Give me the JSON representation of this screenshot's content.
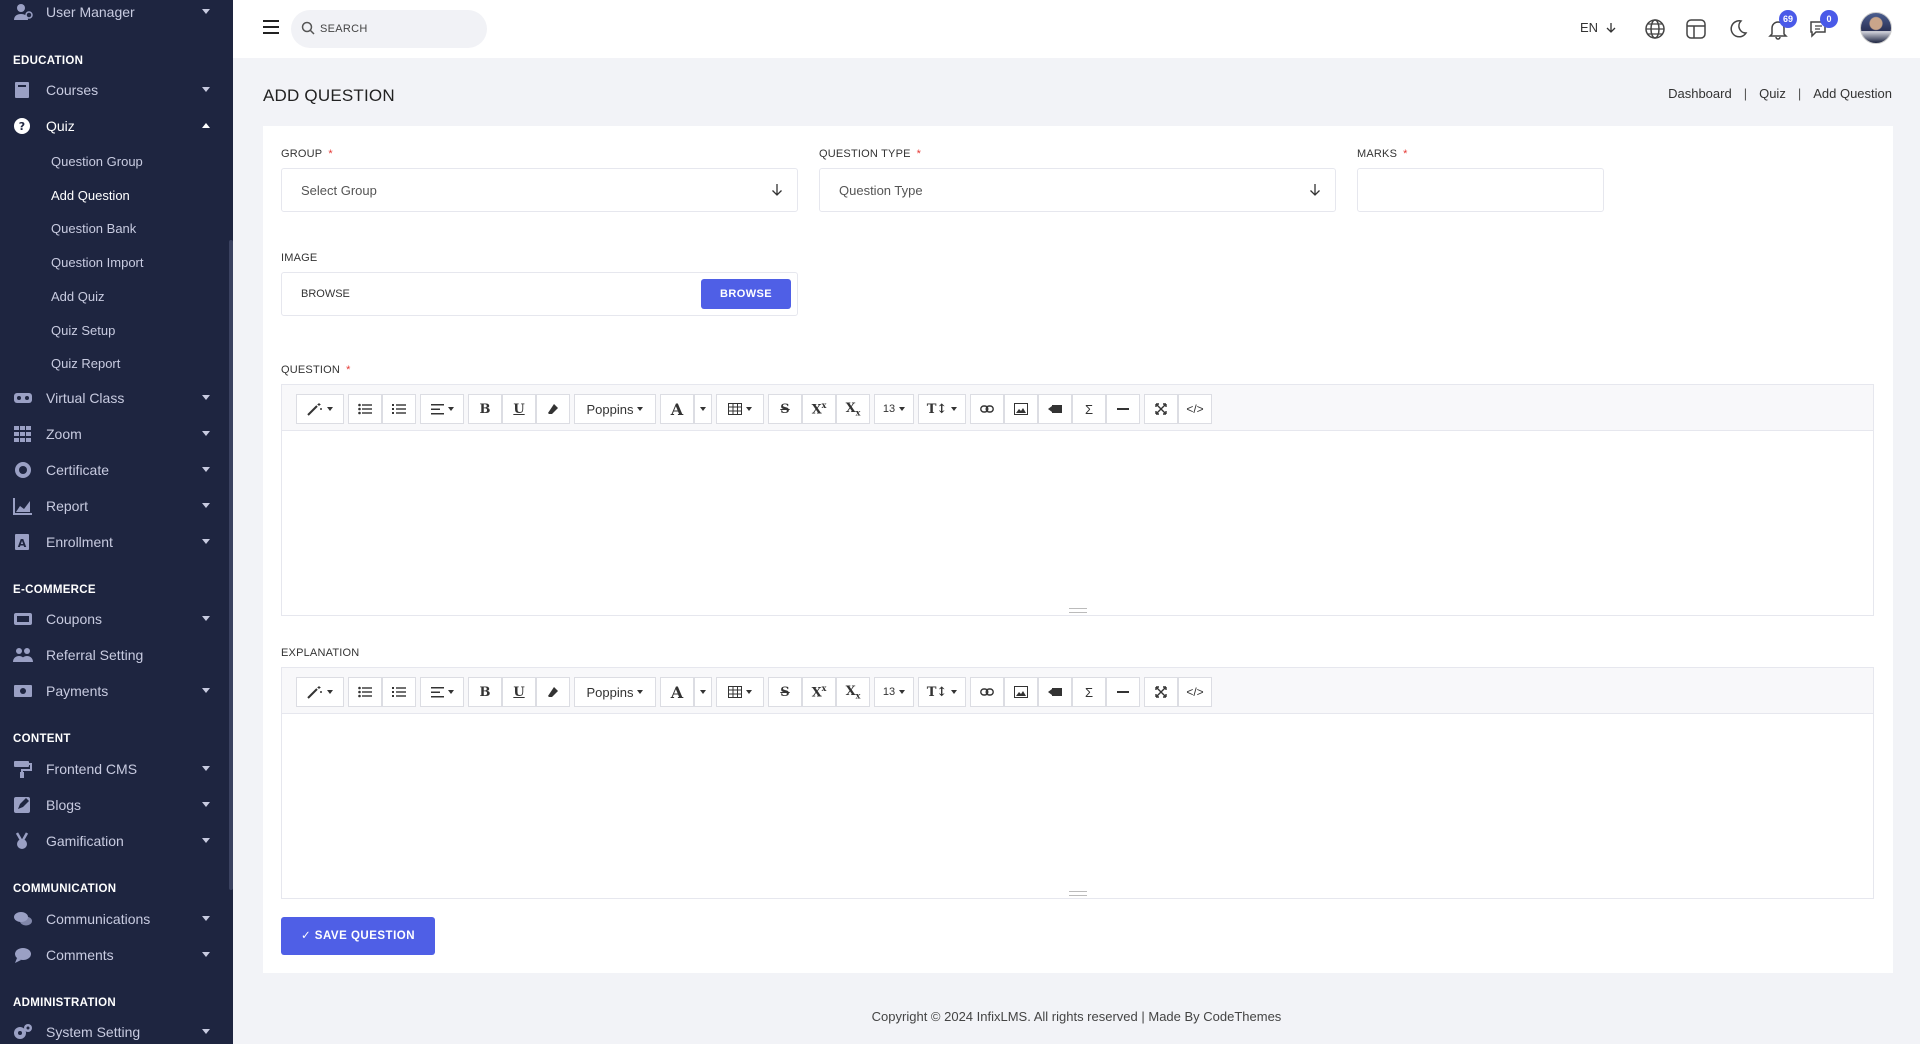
{
  "sidebar": {
    "top_item": {
      "label": "User Manager",
      "icon": "user-gear-icon"
    },
    "sections": [
      {
        "heading": "EDUCATION"
      },
      {
        "heading": "E-COMMERCE"
      },
      {
        "heading": "CONTENT"
      },
      {
        "heading": "COMMUNICATION"
      },
      {
        "heading": "ADMINISTRATION"
      }
    ],
    "items": {
      "courses": "Courses",
      "quiz": "Quiz",
      "virtual_class": "Virtual Class",
      "zoom": "Zoom",
      "certificate": "Certificate",
      "report": "Report",
      "enrollment": "Enrollment",
      "coupons": "Coupons",
      "referral_setting": "Referral Setting",
      "payments": "Payments",
      "frontend_cms": "Frontend CMS",
      "blogs": "Blogs",
      "gamification": "Gamification",
      "communications": "Communications",
      "comments": "Comments",
      "system_setting": "System Setting"
    },
    "quiz_sub": {
      "question_group": "Question Group",
      "add_question": "Add Question",
      "question_bank": "Question Bank",
      "question_import": "Question Import",
      "add_quiz": "Add Quiz",
      "quiz_setup": "Quiz Setup",
      "quiz_report": "Quiz Report"
    }
  },
  "header": {
    "search_placeholder": "SEARCH",
    "language": "EN",
    "notifications_count": "69",
    "messages_count": "0"
  },
  "page": {
    "title": "ADD QUESTION",
    "breadcrumb": [
      "Dashboard",
      "Quiz",
      "Add Question"
    ],
    "breadcrumb_sep": "|"
  },
  "form": {
    "group_label": "GROUP",
    "group_placeholder": "Select Group",
    "question_type_label": "QUESTION TYPE",
    "question_type_placeholder": "Question Type",
    "marks_label": "MARKS",
    "required_mark": "*",
    "image_label": "IMAGE",
    "image_file_text": "BROWSE",
    "browse_button": "BROWSE",
    "question_label": "QUESTION",
    "explanation_label": "EXPLANATION",
    "font_name": "Poppins",
    "font_size": "13",
    "save_button": "✓ SAVE QUESTION"
  },
  "footer": {
    "text": "Copyright © 2024 InfixLMS. All rights reserved | Made By CodeThemes"
  },
  "colors": {
    "sidebar_bg": "#1e2540",
    "accent": "#4f5fe6",
    "required": "#e53935"
  }
}
